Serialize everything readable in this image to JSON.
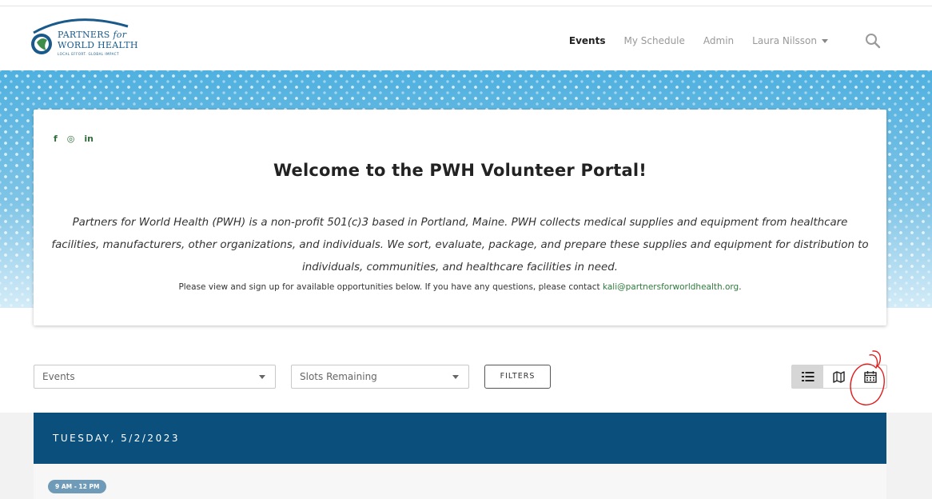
{
  "logo": {
    "line1": "PARTNERS",
    "line1_suffix": "for",
    "line2": "WORLD HEALTH",
    "tagline": "LOCAL EFFORT. GLOBAL IMPACT"
  },
  "nav": {
    "items": [
      "Events",
      "My Schedule",
      "Admin"
    ],
    "user": "Laura Nilsson",
    "active": "Events"
  },
  "hero": {
    "social": [
      "f",
      "◎",
      "in"
    ],
    "title": "Welcome to the PWH Volunteer Portal!",
    "description": "Partners for World Health (PWH) is a non-profit 501(c)3 based in Portland, Maine. PWH collects medical supplies and equipment from healthcare facilities, manufacturers, other organizations, and individuals. We sort, evaluate, package, and prepare these supplies and equipment for distribution to individuals, communities, and healthcare facilities in need.",
    "contact_prefix": "Please view and sign up for available opportunities below. If you have any questions, please contact ",
    "contact_email": "kali@partnersforworldhealth.org",
    "contact_suffix": "."
  },
  "filters": {
    "events_select": "Events",
    "slots_select": "Slots Remaining",
    "filters_button": "FILTERS"
  },
  "view_toggle": {
    "active": "list",
    "options": [
      "list",
      "map",
      "calendar"
    ]
  },
  "schedule": {
    "day": "TUESDAY, 5/2/2023",
    "time": "9 AM - 12 PM"
  },
  "colors": {
    "brand_blue": "#0b4f7c",
    "link_green": "#2e7a3c",
    "pill": "#6f9bb8"
  }
}
